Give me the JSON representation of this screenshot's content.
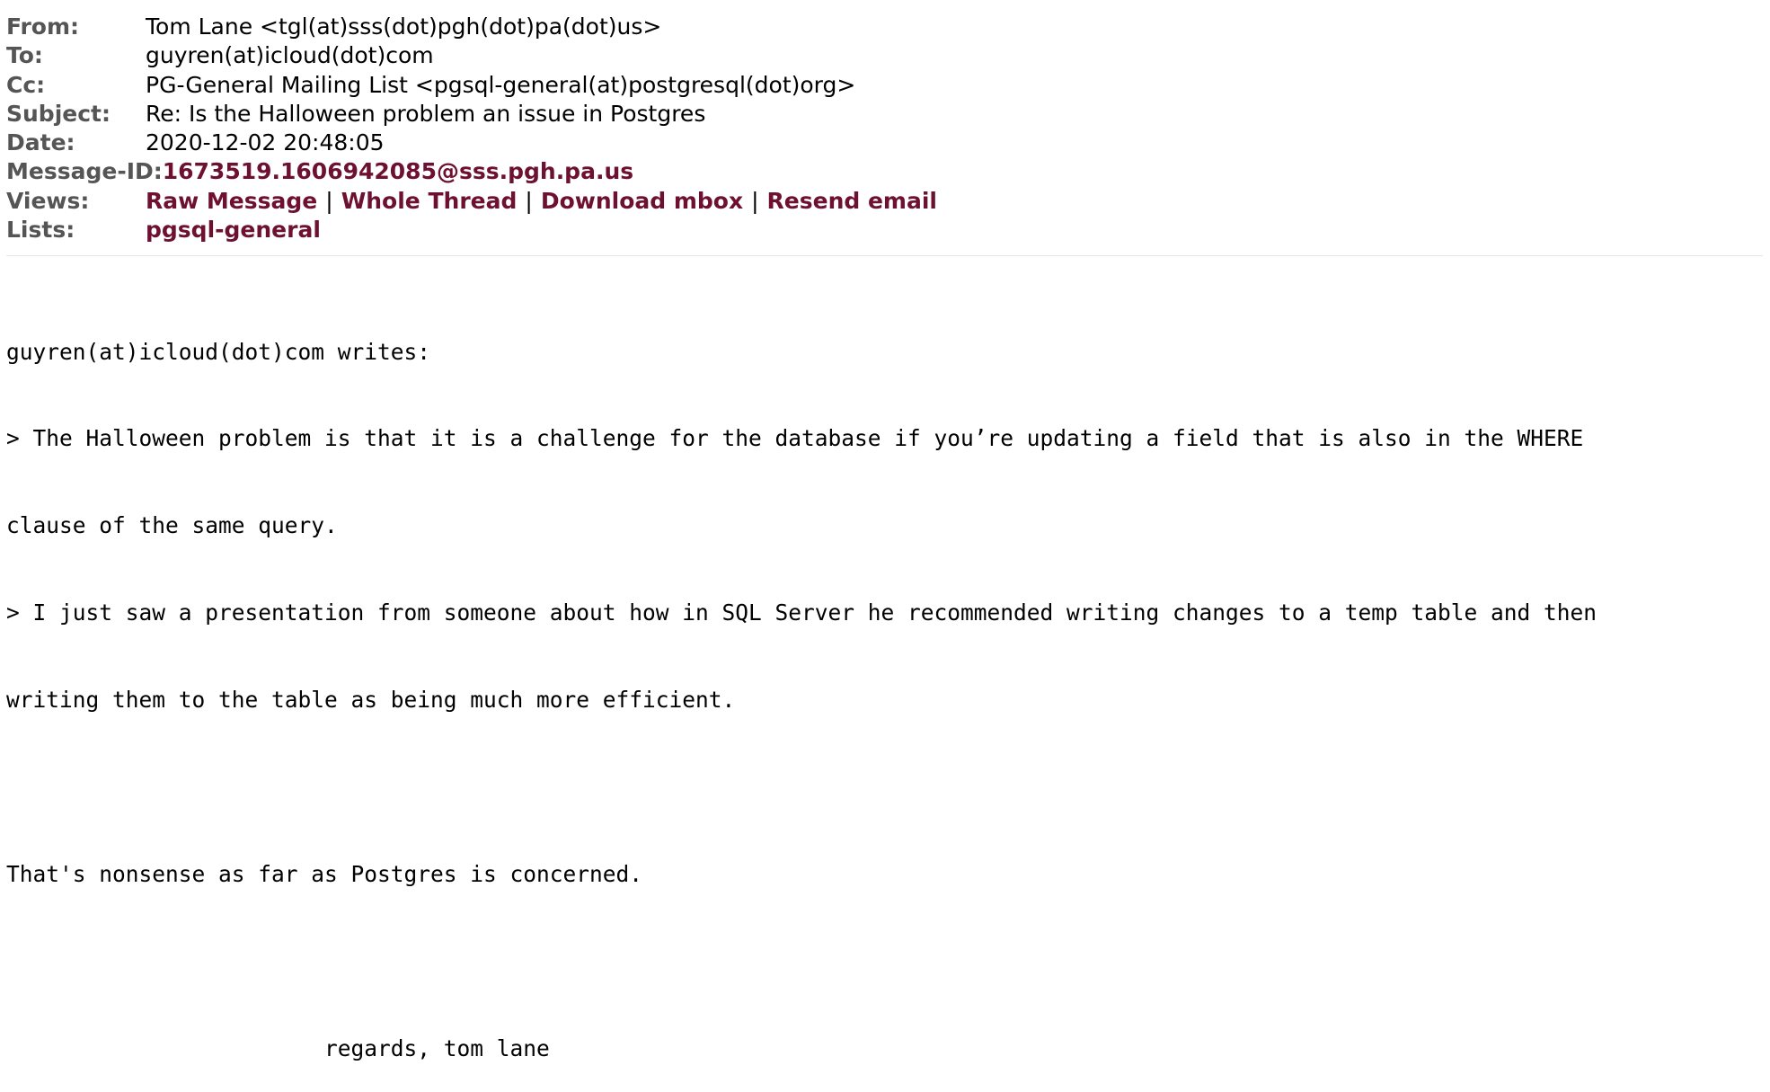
{
  "headers": {
    "from_label": "From:",
    "from_value": "Tom Lane <tgl(at)sss(dot)pgh(dot)pa(dot)us>",
    "to_label": "To:",
    "to_value": "guyren(at)icloud(dot)com",
    "cc_label": "Cc:",
    "cc_value": "PG-General Mailing List <pgsql-general(at)postgresql(dot)org>",
    "subject_label": "Subject:",
    "subject_value": "Re: Is the Halloween problem an issue in Postgres",
    "date_label": "Date:",
    "date_value": "2020-12-02 20:48:05",
    "message_id_label": "Message-ID:",
    "message_id_value": "1673519.1606942085@sss.pgh.pa.us",
    "views_label": "Views:",
    "views_links": {
      "raw_message": "Raw Message",
      "whole_thread": "Whole Thread",
      "download_mbox": "Download mbox",
      "resend_email": "Resend email"
    },
    "views_separator": "|",
    "lists_label": "Lists:",
    "lists_value": "pgsql-general"
  },
  "body": {
    "lines": [
      "guyren(at)icloud(dot)com writes:",
      "> The Halloween problem is that it is a challenge for the database if you’re updating a field that is also in the WHERE",
      "clause of the same query.",
      "> I just saw a presentation from someone about how in SQL Server he recommended writing changes to a temp table and then",
      "writing them to the table as being much more efficient.",
      "",
      "That's nonsense as far as Postgres is concerned.",
      "",
      "                        regards, tom lane"
    ]
  },
  "colors": {
    "label": "#555555",
    "link": "#6e1031",
    "divider": "#e6e6e6"
  }
}
